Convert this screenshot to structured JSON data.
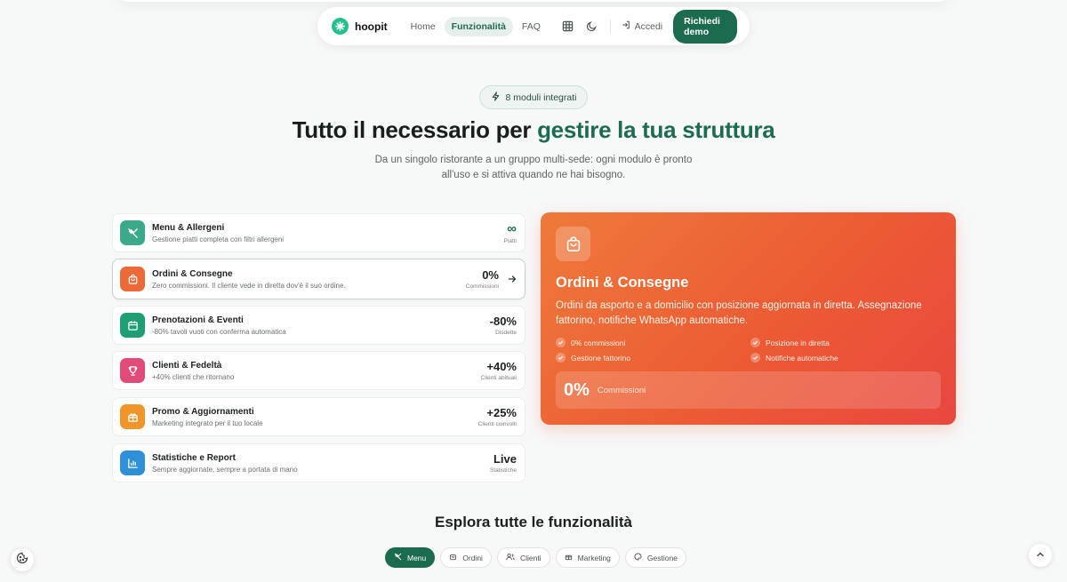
{
  "nav": {
    "brand": "hoopit",
    "links": [
      "Home",
      "Funzionalità",
      "FAQ"
    ],
    "active_link": "Funzionalità",
    "login_label": "Accedi",
    "cta_label": "Richiedi demo",
    "icons": [
      "grid-icon",
      "moon-icon",
      "login-icon"
    ]
  },
  "hero": {
    "badge": "8 moduli integrati",
    "title_plain": "Tutto il necessario per ",
    "title_accent": "gestire la tua struttura",
    "subtitle_line1": "Da un singolo ristorante a un gruppo multi-sede: ogni modulo è pronto",
    "subtitle_line2": "all'uso e si attiva quando ne hai bisogno."
  },
  "modules": [
    {
      "title": "Menu & Allergeni",
      "desc": "Gestione piatti completa con filtri allergeni",
      "value": "∞",
      "label": "Piatti",
      "color": "#3aaa8a"
    },
    {
      "title": "Ordini & Consegne",
      "desc": "Zero commissioni. Il cliente vede in diretta dov'è il suo ordine.",
      "value": "0%",
      "label": "Commissioni",
      "color": "#ec6a37"
    },
    {
      "title": "Prenotazioni & Eventi",
      "desc": "-80% tavoli vuoti con conferma automatica",
      "value": "-80%",
      "label": "Disdette",
      "color": "#1f9e74"
    },
    {
      "title": "Clienti & Fedeltà",
      "desc": "+40% clienti che ritornano",
      "value": "+40%",
      "label": "Clienti abituali",
      "color": "#e04b78"
    },
    {
      "title": "Promo & Aggiornamenti",
      "desc": "Marketing integrato per il tuo locale",
      "value": "+25%",
      "label": "Clienti coinvolti",
      "color": "#f0952a"
    },
    {
      "title": "Statistiche e Report",
      "desc": "Sempre aggiornate, sempre a portata di mano",
      "value": "Live",
      "label": "Statistiche",
      "color": "#2f8fd8"
    }
  ],
  "detail": {
    "title": "Ordini & Consegne",
    "desc": "Ordini da asporto e a domicilio con posizione aggiornata in diretta. Assegnazione fattorino, notifiche WhatsApp automatiche.",
    "features": [
      "0% commissioni",
      "Posizione in diretta",
      "Gestione fattorino",
      "Notifiche automatiche"
    ],
    "kpi_value": "0%",
    "kpi_label": "Commissioni"
  },
  "explore": {
    "title": "Esplora tutte le funzionalità",
    "tabs": [
      "Menu",
      "Ordini",
      "Clienti",
      "Marketing",
      "Gestione"
    ],
    "active_tab": "Menu"
  }
}
